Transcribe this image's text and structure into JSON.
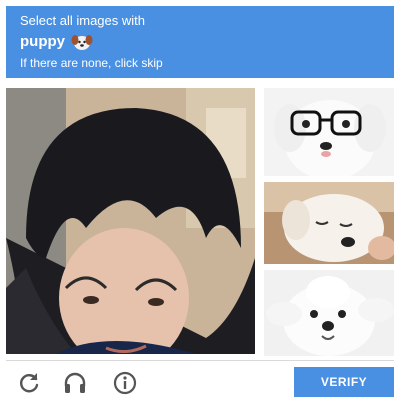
{
  "header": {
    "instruction": "Select all images with",
    "keyword": "puppy",
    "keyword_icon": "puppy-face-emoji",
    "hint": "If there are none, click skip"
  },
  "tiles": [
    {
      "name": "tile-person-selfie",
      "depicts": "person selfie"
    },
    {
      "name": "tile-puppy-glasses",
      "depicts": "white puppy wearing glasses"
    },
    {
      "name": "tile-puppy-sleepy",
      "depicts": "white puppy with eyes closed"
    },
    {
      "name": "tile-puppy-fluffy",
      "depicts": "fluffy white puppy"
    }
  ],
  "footer": {
    "icons": [
      "reload-icon",
      "audio-headphones-icon",
      "info-icon"
    ],
    "verify_label": "VERIFY"
  },
  "colors": {
    "accent": "#4a90e2",
    "divider": "#d9d9d9",
    "icon": "#555555"
  }
}
